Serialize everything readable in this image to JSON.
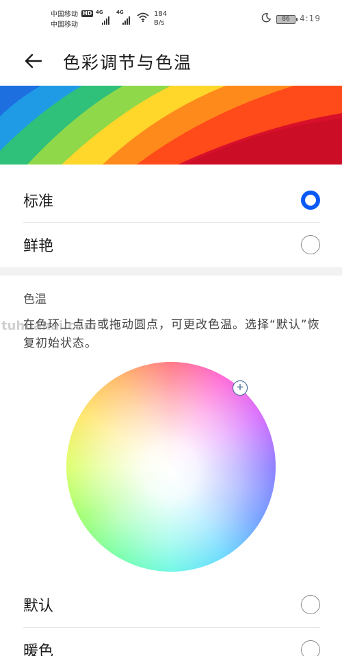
{
  "status_bar": {
    "carrier_1": "中国移动",
    "carrier_2": "中国移动",
    "hd": "HD",
    "network_1": "4G",
    "network_2": "4G",
    "speed_value": "184",
    "speed_unit": "B/s",
    "battery": "86",
    "time": "4:19"
  },
  "header": {
    "back_icon": "arrow-left-icon",
    "title": "色彩调节与色温"
  },
  "color_modes": [
    {
      "label": "标准",
      "selected": true
    },
    {
      "label": "鲜艳",
      "selected": false
    }
  ],
  "temperature": {
    "title": "色温",
    "description": "在色环上点击或拖动圆点，可更改色温。选择“默认”恢复初始状态。",
    "handle_icon": "plus-icon"
  },
  "temperature_options": [
    {
      "label": "默认",
      "selected": false
    },
    {
      "label": "暖色",
      "selected": false
    }
  ],
  "watermark": "tuhuanai.com",
  "colors": {
    "accent": "#0a59f7",
    "divider": "#e6e6e6"
  }
}
